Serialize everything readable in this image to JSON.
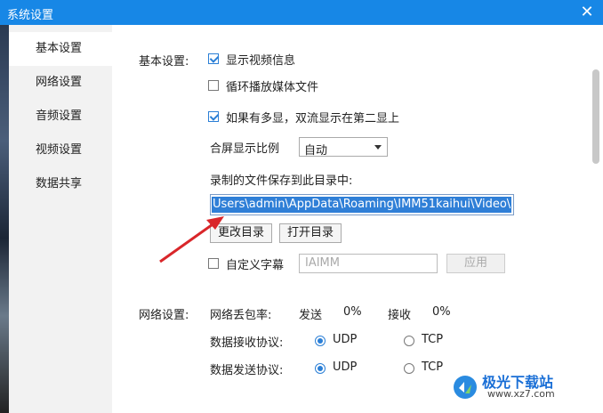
{
  "window": {
    "title": "系统设置"
  },
  "sidebar": {
    "items": [
      {
        "label": "基本设置",
        "active": true
      },
      {
        "label": "网络设置"
      },
      {
        "label": "音频设置"
      },
      {
        "label": "视频设置"
      },
      {
        "label": "数据共享"
      }
    ]
  },
  "basic": {
    "section_label": "基本设置:",
    "show_video_info": {
      "label": "显示视频信息",
      "checked": true
    },
    "loop_media": {
      "label": "循环播放媒体文件",
      "checked": false
    },
    "dual_display": {
      "label": "如果有多显，双流显示在第二显上",
      "checked": true
    },
    "ratio_label": "合屏显示比例",
    "ratio_value": "自动",
    "save_dir_label": "录制的文件保存到此目录中:",
    "save_dir_value": "Users\\admin\\AppData\\Roaming\\IMM51kaihui\\Video\\",
    "change_dir_button": "更改目录",
    "open_dir_button": "打开目录",
    "custom_subtitle": {
      "label": "自定义字幕",
      "checked": false
    },
    "subtitle_placeholder": "IAIMM",
    "apply_button": "应用"
  },
  "network": {
    "section_label": "网络设置:",
    "loss_label": "网络丢包率:",
    "send_label": "发送",
    "send_value": "0%",
    "recv_label": "接收",
    "recv_value": "0%",
    "recv_protocol_label": "数据接收协议:",
    "send_protocol_label": "数据发送协议:",
    "udp": "UDP",
    "tcp": "TCP"
  },
  "watermark": {
    "text": "极光下载站",
    "url": "www.xz7.com"
  },
  "colors": {
    "titlebar": "#1787e6",
    "selection": "#2f7fd7",
    "arrow": "#d9262a"
  }
}
